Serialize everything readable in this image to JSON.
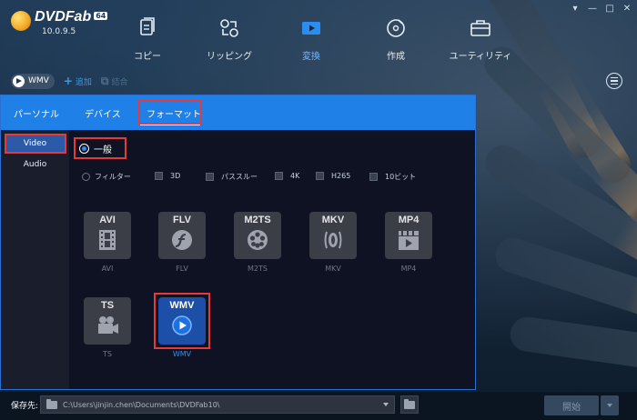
{
  "app": {
    "name": "DVDFab",
    "badge": "64",
    "version": "10.0.9.5"
  },
  "nav": {
    "items": [
      {
        "label": "コピー",
        "icon": "copy-icon"
      },
      {
        "label": "リッピング",
        "icon": "ripper-icon"
      },
      {
        "label": "変換",
        "icon": "converter-icon",
        "active": true
      },
      {
        "label": "作成",
        "icon": "creator-icon"
      },
      {
        "label": "ユーティリティ",
        "icon": "toolbox-icon"
      }
    ]
  },
  "window_controls": [
    "▾",
    "—",
    "□",
    "✕"
  ],
  "toolbar": {
    "profile_label": "WMV",
    "add_label": "追加",
    "merge_label": "結合"
  },
  "tabs": {
    "personal": "パーソナル",
    "device": "デバイス",
    "format": "フォーマット"
  },
  "sidebar": {
    "video": "Video",
    "audio": "Audio"
  },
  "options": {
    "general_label": "一般",
    "filter_label": "フィルター",
    "checkboxes": [
      "3D",
      "パススルー",
      "4K",
      "H265",
      "10ビット"
    ]
  },
  "formats": [
    {
      "title": "AVI",
      "caption": "AVI",
      "icon": "film-icon"
    },
    {
      "title": "FLV",
      "caption": "FLV",
      "icon": "flash-icon"
    },
    {
      "title": "M2TS",
      "caption": "M2TS",
      "icon": "reel-icon"
    },
    {
      "title": "MKV",
      "caption": "MKV",
      "icon": "matroska-icon"
    },
    {
      "title": "MP4",
      "caption": "MP4",
      "icon": "clapper-icon"
    },
    {
      "title": "TS",
      "caption": "TS",
      "icon": "camera-icon"
    },
    {
      "title": "WMV",
      "caption": "WMV",
      "icon": "play-icon",
      "selected": true
    }
  ],
  "bottom": {
    "save_label": "保存先:",
    "path": "C:\\Users\\jinjin.chen\\Documents\\DVDFab10\\",
    "start_label": "開始"
  },
  "colors": {
    "accent": "#1f80e8",
    "highlight": "#e33b3b",
    "selected_tile": "#1b4fa8"
  }
}
